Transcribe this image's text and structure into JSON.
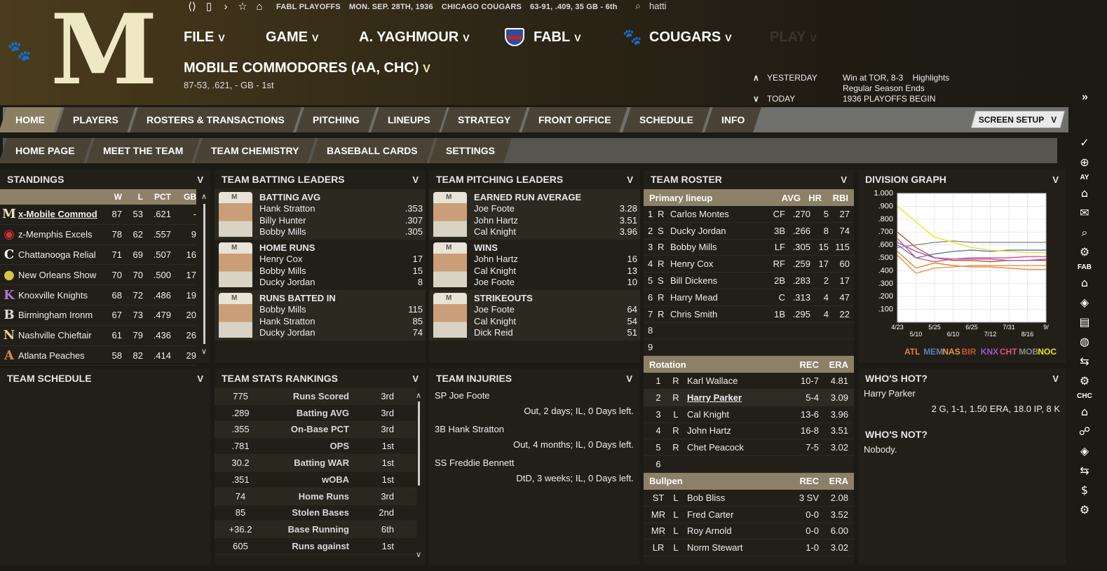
{
  "topbar": {
    "context1": "FABL PLAYOFFS",
    "context2": "MON. SEP. 28TH, 1936",
    "context3": "CHICAGO COUGARS",
    "context4": "63-91, .409, 35 GB - 6th",
    "search_value": "hatti"
  },
  "menu": {
    "file": "FILE",
    "game": "GAME",
    "manager": "A. YAGHMOUR",
    "fabl": "FABL",
    "cougars": "COUGARS",
    "play": "PLAY",
    "chevron": "V"
  },
  "team": {
    "logo_letter": "M",
    "title": "MOBILE COMMODORES (AA, CHC)",
    "record": "87-53, .621, - GB - 1st"
  },
  "news": {
    "yesterday_label": "YESTERDAY",
    "yesterday_text": "Win at TOR, 8-3",
    "highlights": "Highlights",
    "regular": "Regular Season Ends",
    "today_label": "TODAY",
    "today_text": "1936 PLAYOFFS BEGIN"
  },
  "tabs": [
    "HOME",
    "PLAYERS",
    "ROSTERS & TRANSACTIONS",
    "PITCHING",
    "LINEUPS",
    "STRATEGY",
    "FRONT OFFICE",
    "SCHEDULE",
    "INFO"
  ],
  "subtabs": [
    "HOME PAGE",
    "MEET THE TEAM",
    "TEAM CHEMISTRY",
    "BASEBALL CARDS",
    "SETTINGS"
  ],
  "screen_setup": "SCREEN SETUP",
  "standings": {
    "title": "STANDINGS",
    "cols": [
      "W",
      "L",
      "PCT",
      "GB"
    ],
    "rows": [
      {
        "icon": "M",
        "name": "x-Mobile Commod",
        "w": "87",
        "l": "53",
        "pct": ".621",
        "gb": "-",
        "color": "#e9e2b8"
      },
      {
        "icon": "◉",
        "name": "z-Memphis Excels",
        "w": "78",
        "l": "62",
        "pct": ".557",
        "gb": "9",
        "color": "#c33"
      },
      {
        "icon": "C",
        "name": "Chattanooga Relial",
        "w": "71",
        "l": "69",
        "pct": ".507",
        "gb": "16",
        "color": "#fff"
      },
      {
        "icon": "●",
        "name": "New Orleans Show",
        "w": "70",
        "l": "70",
        "pct": ".500",
        "gb": "17",
        "color": "#d9c24a"
      },
      {
        "icon": "K",
        "name": "Knoxville Knights",
        "w": "68",
        "l": "72",
        "pct": ".486",
        "gb": "19",
        "color": "#a879d9"
      },
      {
        "icon": "B",
        "name": "Birmingham Ironm",
        "w": "67",
        "l": "73",
        "pct": ".479",
        "gb": "20",
        "color": "#ddd"
      },
      {
        "icon": "N",
        "name": "Nashville Chieftair",
        "w": "61",
        "l": "79",
        "pct": ".436",
        "gb": "26",
        "color": "#e6d190"
      },
      {
        "icon": "A",
        "name": "Atlanta Peaches",
        "w": "58",
        "l": "82",
        "pct": ".414",
        "gb": "29",
        "color": "#d98b4a"
      }
    ]
  },
  "batting": {
    "title": "TEAM BATTING LEADERS",
    "blocks": [
      {
        "title": "BATTING AVG",
        "rows": [
          [
            "Hank Stratton",
            ".353"
          ],
          [
            "Billy Hunter",
            ".307"
          ],
          [
            "Bobby Mills",
            ".305"
          ]
        ]
      },
      {
        "title": "HOME RUNS",
        "rows": [
          [
            "Henry Cox",
            "17"
          ],
          [
            "Bobby Mills",
            "15"
          ],
          [
            "Ducky Jordan",
            "8"
          ]
        ]
      },
      {
        "title": "RUNS BATTED IN",
        "rows": [
          [
            "Bobby Mills",
            "115"
          ],
          [
            "Hank Stratton",
            "85"
          ],
          [
            "Ducky Jordan",
            "74"
          ]
        ]
      }
    ]
  },
  "pitching": {
    "title": "TEAM PITCHING LEADERS",
    "blocks": [
      {
        "title": "EARNED RUN AVERAGE",
        "rows": [
          [
            "Joe Foote",
            "3.28"
          ],
          [
            "John Hartz",
            "3.51"
          ],
          [
            "Cal Knight",
            "3.96"
          ]
        ]
      },
      {
        "title": "WINS",
        "rows": [
          [
            "John Hartz",
            "16"
          ],
          [
            "Cal Knight",
            "13"
          ],
          [
            "Joe Foote",
            "10"
          ]
        ]
      },
      {
        "title": "STRIKEOUTS",
        "rows": [
          [
            "Joe Foote",
            "64"
          ],
          [
            "Cal Knight",
            "54"
          ],
          [
            "Dick Reid",
            "51"
          ]
        ]
      }
    ]
  },
  "roster": {
    "title": "TEAM ROSTER",
    "lineup_header": [
      "Primary lineup",
      "AVG",
      "HR",
      "RBI"
    ],
    "lineup": [
      [
        "1",
        "R",
        "Carlos Montes",
        "CF",
        ".270",
        "5",
        "27"
      ],
      [
        "2",
        "S",
        "Ducky Jordan",
        "3B",
        ".266",
        "8",
        "74"
      ],
      [
        "3",
        "R",
        "Bobby Mills",
        "LF",
        ".305",
        "15",
        "115"
      ],
      [
        "4",
        "R",
        "Henry Cox",
        "RF",
        ".259",
        "17",
        "60"
      ],
      [
        "5",
        "S",
        "Bill Dickens",
        "2B",
        ".283",
        "2",
        "17"
      ],
      [
        "6",
        "R",
        "Harry Mead",
        "C",
        ".313",
        "4",
        "47"
      ],
      [
        "7",
        "R",
        "Chris Smith",
        "1B",
        ".295",
        "4",
        "22"
      ],
      [
        "8",
        "",
        "",
        "",
        "",
        "",
        ""
      ],
      [
        "9",
        "",
        "",
        "",
        "",
        "",
        ""
      ]
    ],
    "rotation_header": [
      "Rotation",
      "REC",
      "ERA"
    ],
    "rotation": [
      [
        "1",
        "R",
        "Karl Wallace",
        "10-7",
        "4.81"
      ],
      [
        "2",
        "R",
        "Harry Parker",
        "5-4",
        "3.09"
      ],
      [
        "3",
        "L",
        "Cal Knight",
        "13-6",
        "3.96"
      ],
      [
        "4",
        "R",
        "John Hartz",
        "16-8",
        "3.51"
      ],
      [
        "5",
        "R",
        "Chet Peacock",
        "7-5",
        "3.02"
      ],
      [
        "6",
        "",
        "",
        "",
        ""
      ]
    ],
    "bullpen_header": [
      "Bullpen",
      "REC",
      "ERA"
    ],
    "bullpen": [
      [
        "ST",
        "L",
        "Bob Bliss",
        "3 SV",
        "2.08"
      ],
      [
        "MR",
        "L",
        "Fred Carter",
        "0-0",
        "3.52"
      ],
      [
        "MR",
        "L",
        "Roy Arnold",
        "0-0",
        "6.00"
      ],
      [
        "LR",
        "L",
        "Norm Stewart",
        "1-0",
        "3.02"
      ]
    ]
  },
  "division": {
    "title": "DIVISION GRAPH"
  },
  "chart_data": {
    "type": "line",
    "title": "DIVISION GRAPH",
    "xlabel": "",
    "ylabel": "",
    "x": [
      "4/23",
      "5/10",
      "5/25",
      "6/10",
      "6/25",
      "7/12",
      "7/31",
      "8/16",
      "9/"
    ],
    "y_ticks": [
      "1.000",
      ".900",
      ".800",
      ".700",
      ".600",
      ".500",
      ".400",
      ".300",
      ".200",
      ".100"
    ],
    "ylim": [
      0,
      1
    ],
    "series": [
      {
        "name": "ATL",
        "color": "#e8823c",
        "values": [
          0.55,
          0.42,
          0.46,
          0.44,
          0.43,
          0.43,
          0.42,
          0.41,
          0.41
        ]
      },
      {
        "name": "MEM",
        "color": "#5e7fb8",
        "values": [
          0.6,
          0.5,
          0.53,
          0.55,
          0.56,
          0.55,
          0.56,
          0.56,
          0.56
        ]
      },
      {
        "name": "NAS",
        "color": "#e59a4a",
        "values": [
          0.52,
          0.38,
          0.42,
          0.43,
          0.44,
          0.44,
          0.44,
          0.44,
          0.44
        ]
      },
      {
        "name": "BIR",
        "color": "#c2582a",
        "values": [
          0.7,
          0.58,
          0.5,
          0.48,
          0.48,
          0.47,
          0.48,
          0.48,
          0.48
        ]
      },
      {
        "name": "KNX",
        "color": "#9b59d0",
        "values": [
          0.62,
          0.55,
          0.5,
          0.49,
          0.49,
          0.49,
          0.48,
          0.48,
          0.49
        ]
      },
      {
        "name": "CHT",
        "color": "#e0577a",
        "values": [
          0.65,
          0.5,
          0.47,
          0.49,
          0.5,
          0.5,
          0.5,
          0.51,
          0.51
        ]
      },
      {
        "name": "MOB",
        "color": "#8a8a8a",
        "values": [
          0.58,
          0.6,
          0.62,
          0.63,
          0.62,
          0.62,
          0.62,
          0.62,
          0.62
        ]
      },
      {
        "name": "NOC",
        "color": "#f2e21c",
        "values": [
          0.9,
          0.78,
          0.66,
          0.62,
          0.58,
          0.56,
          0.55,
          0.54,
          0.54
        ]
      }
    ]
  },
  "schedule": {
    "title": "TEAM SCHEDULE"
  },
  "rankings": {
    "title": "TEAM STATS RANKINGS",
    "rows": [
      [
        "775",
        "Runs Scored",
        "3rd"
      ],
      [
        ".289",
        "Batting AVG",
        "3rd"
      ],
      [
        ".355",
        "On-Base PCT",
        "3rd"
      ],
      [
        ".781",
        "OPS",
        "1st"
      ],
      [
        "30.2",
        "Batting WAR",
        "1st"
      ],
      [
        ".351",
        "wOBA",
        "1st"
      ],
      [
        "74",
        "Home Runs",
        "3rd"
      ],
      [
        "85",
        "Stolen Bases",
        "2nd"
      ],
      [
        "+36.2",
        "Base Running",
        "6th"
      ],
      [
        "605",
        "Runs against",
        "1st"
      ]
    ]
  },
  "injuries": {
    "title": "TEAM INJURIES",
    "rows": [
      {
        "player": "SP Joe Foote",
        "desc": "Out, 2 days; IL, 0 Days left."
      },
      {
        "player": "3B Hank Stratton",
        "desc": "Out, 4 months; IL, 0 Days left."
      },
      {
        "player": "SS Freddie Bennett",
        "desc": "DtD, 3 weeks; IL, 0 Days left."
      }
    ]
  },
  "hot": {
    "title": "WHO'S HOT?",
    "player": "Harry Parker",
    "line": "2 G, 1-1, 1.50 ERA, 18.0 IP, 8 K"
  },
  "not": {
    "title": "WHO'S NOT?",
    "text": "Nobody."
  },
  "sidebar": {
    "ay": "AY",
    "fab": "FAB",
    "chc": "CHC"
  }
}
